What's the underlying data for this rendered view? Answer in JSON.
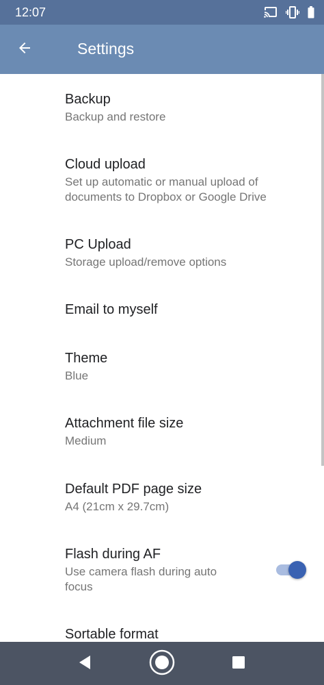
{
  "status_bar": {
    "time": "12:07",
    "icons": [
      "cast-icon",
      "vibrate-icon",
      "battery-icon"
    ]
  },
  "app_bar": {
    "title": "Settings",
    "back_icon": "arrow-back-icon"
  },
  "settings": [
    {
      "title": "Backup",
      "subtitle": "Backup and restore"
    },
    {
      "title": "Cloud upload",
      "subtitle": "Set up automatic or manual upload of documents to Dropbox or Google Drive"
    },
    {
      "title": "PC Upload",
      "subtitle": "Storage upload/remove options"
    },
    {
      "title": "Email to myself",
      "subtitle": ""
    },
    {
      "title": "Theme",
      "subtitle": "Blue"
    },
    {
      "title": "Attachment file size",
      "subtitle": "Medium"
    },
    {
      "title": "Default PDF page size",
      "subtitle": "A4 (21cm x 29.7cm)"
    },
    {
      "title": "Flash during AF",
      "subtitle": "Use camera flash during auto focus",
      "toggle": true
    },
    {
      "title": "Sortable format",
      "subtitle": ""
    }
  ],
  "nav_bar": {
    "icons": [
      "nav-back-icon",
      "nav-home-icon",
      "nav-recents-icon"
    ]
  },
  "colors": {
    "status_bar": "#56719a",
    "app_bar": "#6b8bb3",
    "accent": "#3a62b2",
    "nav_bar": "#4c5463"
  }
}
